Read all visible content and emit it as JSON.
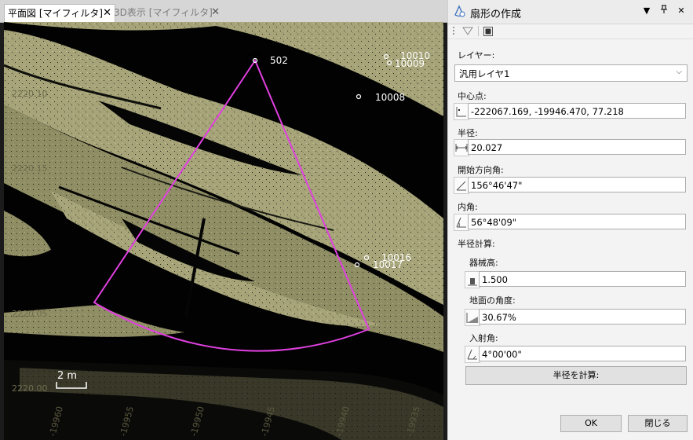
{
  "tabs": [
    {
      "label": "平面図 [マイフィルタ]",
      "close": "✕",
      "active": true
    },
    {
      "label": "3D表示 [マイフィルタ]",
      "close": "✕",
      "active": false
    }
  ],
  "map": {
    "points": [
      {
        "label": "502"
      },
      {
        "label": "10010"
      },
      {
        "label": "10009"
      },
      {
        "label": "10008"
      },
      {
        "label": "10016"
      },
      {
        "label": "10017"
      }
    ],
    "faint_labels": [
      "2220.10",
      "2220.15",
      "2220.05",
      "2220.00"
    ],
    "axis_ticks": [
      "-19960",
      "-19955",
      "-19950",
      "-19945",
      "-19940",
      "-19935"
    ],
    "scale_bar": "2 m",
    "colors": {
      "pointcloud": "#a8a67a",
      "pointcloud_dark": "#7d7c58",
      "sector": "#e040e0",
      "background": "#020202"
    }
  },
  "panel": {
    "title": "扇形の作成",
    "header_icons": [
      "pin-icon",
      "close-icon"
    ],
    "layer": {
      "label": "レイヤー:",
      "value": "汎用レイヤ1"
    },
    "center": {
      "label": "中心点:",
      "value": "-222067.169, -19946.470, 77.218"
    },
    "radius": {
      "label": "半径:",
      "value": "20.027"
    },
    "start_angle": {
      "label": "開始方向角:",
      "value": "156°46'47\""
    },
    "inner_angle": {
      "label": "内角:",
      "value": "56°48'09\""
    },
    "radius_calc": {
      "label": "半径計算:"
    },
    "instrument_height": {
      "label": "器械高:",
      "value": "1.500"
    },
    "ground_angle": {
      "label": "地面の角度:",
      "value": "30.67%"
    },
    "incidence_angle": {
      "label": "入射角:",
      "value": "4°00'00\""
    },
    "calc_button": "半径を計算:",
    "ok_button": "OK",
    "close_button": "閉じる"
  }
}
